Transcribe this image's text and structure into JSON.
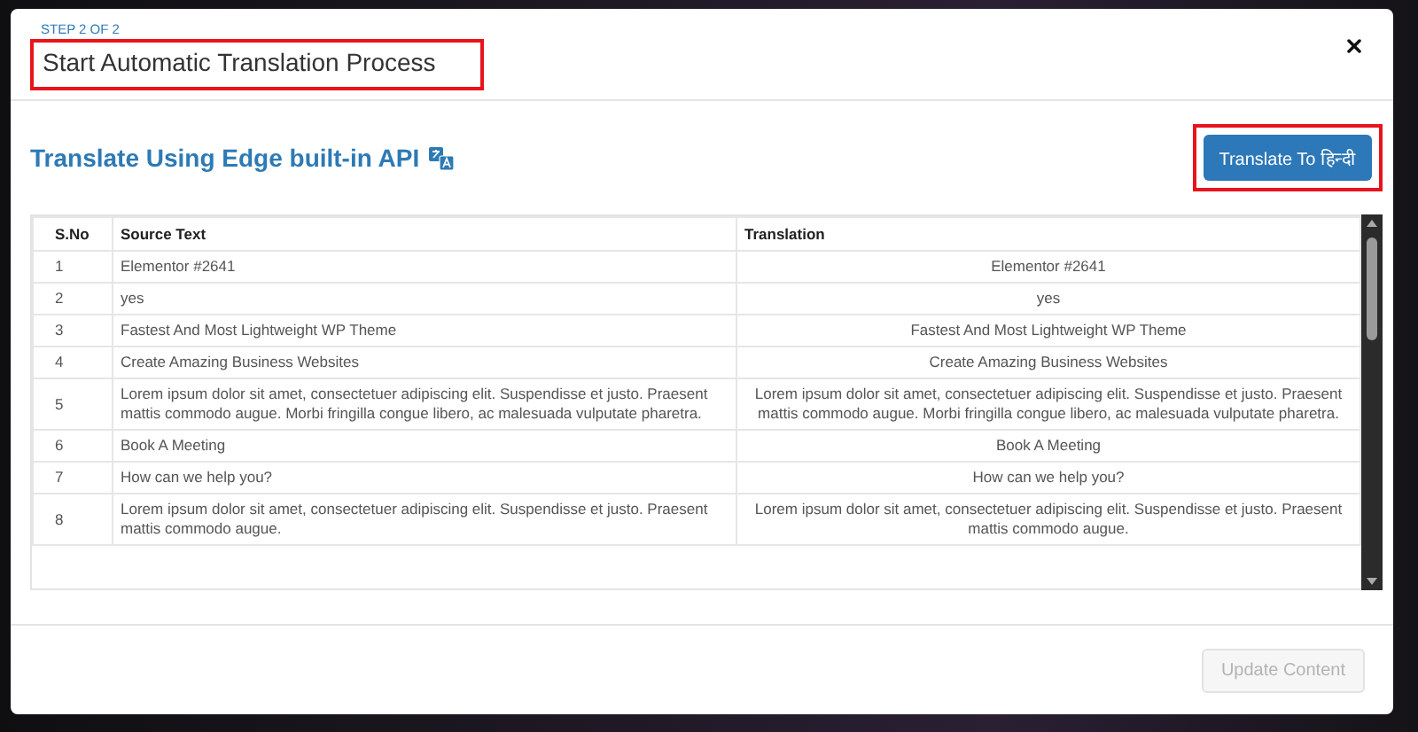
{
  "modal": {
    "step": "STEP 2 OF 2",
    "title": "Start Automatic Translation Process",
    "title_highlighted": true
  },
  "section": {
    "heading": "Translate Using Edge built-in API",
    "button": {
      "label": "Translate To हिन्दी",
      "highlighted": true
    }
  },
  "table": {
    "columns": [
      "S.No",
      "Source Text",
      "Translation"
    ],
    "rows": [
      {
        "no": "1",
        "source": "Elementor #2641",
        "translation": "Elementor #2641"
      },
      {
        "no": "2",
        "source": "yes",
        "translation": "yes"
      },
      {
        "no": "3",
        "source": "Fastest And Most Lightweight WP Theme",
        "translation": "Fastest And Most Lightweight WP Theme"
      },
      {
        "no": "4",
        "source": "Create Amazing Business Websites",
        "translation": "Create Amazing Business Websites"
      },
      {
        "no": "5",
        "source": "Lorem ipsum dolor sit amet, consectetuer adipiscing elit. Suspendisse et justo. Praesent mattis commodo augue. Morbi fringilla congue libero, ac malesuada vulputate pharetra.",
        "translation": "Lorem ipsum dolor sit amet, consectetuer adipiscing elit. Suspendisse et justo. Praesent mattis commodo augue. Morbi fringilla congue libero, ac malesuada vulputate pharetra."
      },
      {
        "no": "6",
        "source": "Book A Meeting",
        "translation": "Book A Meeting"
      },
      {
        "no": "7",
        "source": "How can we help you?",
        "translation": "How can we help you?"
      },
      {
        "no": "8",
        "source": "Lorem ipsum dolor sit amet, consectetuer adipiscing elit. Suspendisse et justo. Praesent mattis commodo augue.",
        "translation": "Lorem ipsum dolor sit amet, consectetuer adipiscing elit. Suspendisse et justo. Praesent mattis commodo augue."
      }
    ]
  },
  "footer": {
    "button": {
      "label": "Update Content",
      "disabled": true
    }
  }
}
